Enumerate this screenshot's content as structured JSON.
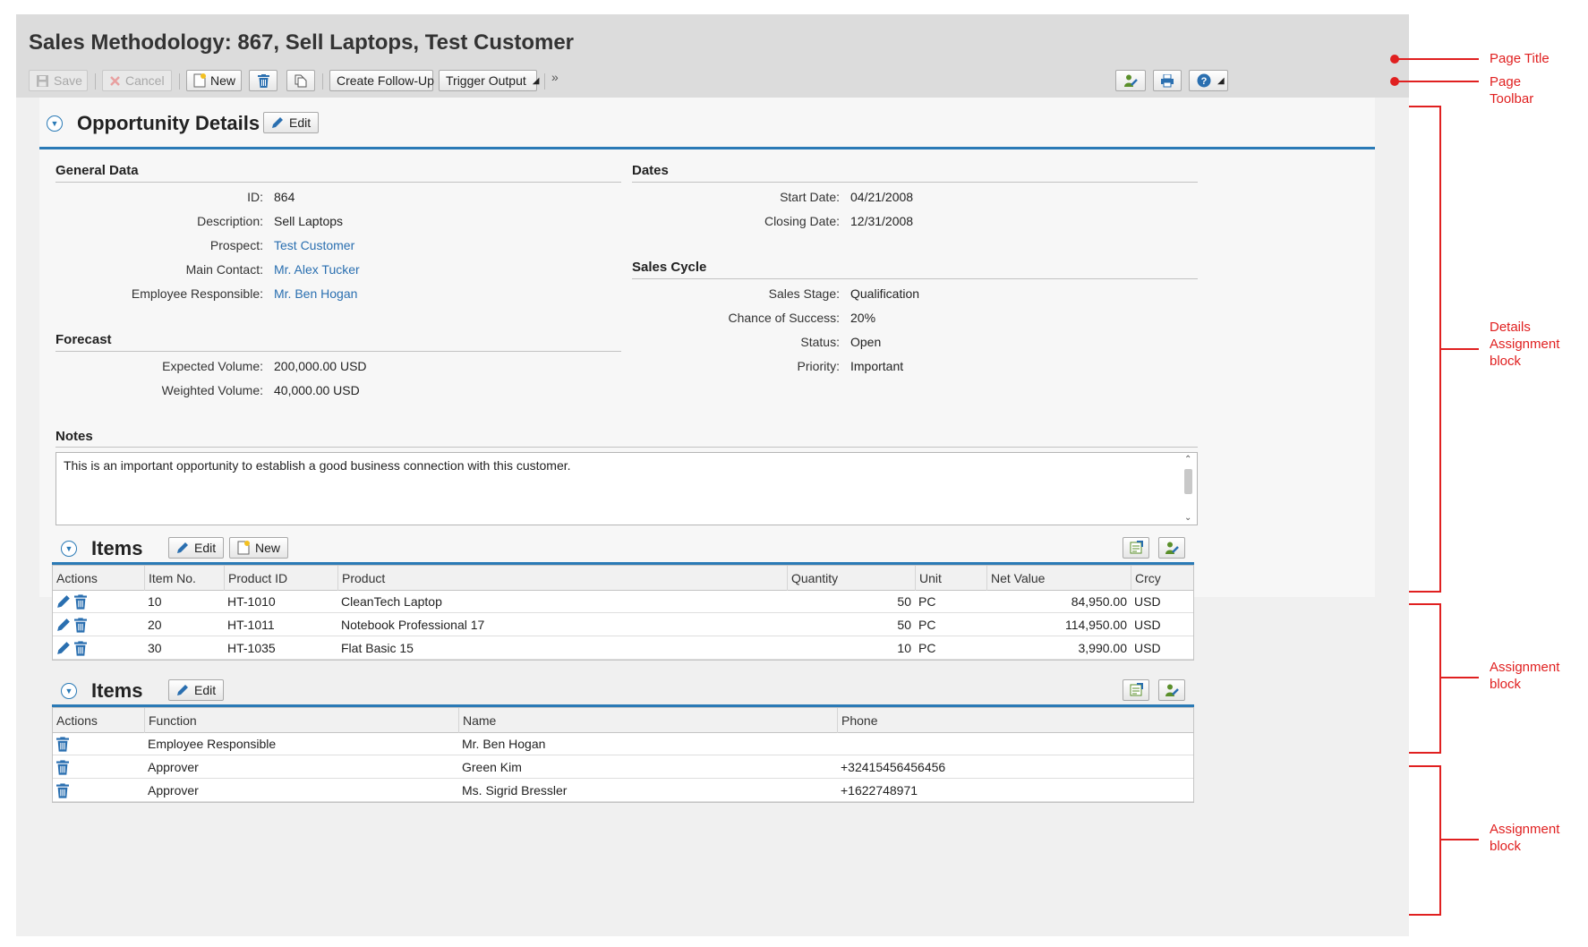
{
  "page": {
    "title": "Sales Methodology: 867, Sell Laptops, Test Customer"
  },
  "toolbar": {
    "save": "Save",
    "cancel": "Cancel",
    "new": "New",
    "create_follow_up": "Create Follow-Up",
    "trigger_output": "Trigger Output",
    "overflow": "»"
  },
  "details": {
    "title": "Opportunity Details",
    "edit": "Edit",
    "general_data": {
      "title": "General Data",
      "fields": [
        {
          "label": "ID:",
          "value": "864",
          "link": false
        },
        {
          "label": "Description:",
          "value": "Sell Laptops",
          "link": false
        },
        {
          "label": "Prospect:",
          "value": "Test Customer",
          "link": true
        },
        {
          "label": "Main Contact:",
          "value": "Mr. Alex Tucker",
          "link": true
        },
        {
          "label": "Employee Responsible:",
          "value": "Mr. Ben Hogan",
          "link": true
        }
      ]
    },
    "forecast": {
      "title": "Forecast",
      "fields": [
        {
          "label": "Expected Volume:",
          "value": "200,000.00 USD"
        },
        {
          "label": "Weighted Volume:",
          "value": "40,000.00 USD"
        }
      ]
    },
    "dates": {
      "title": "Dates",
      "fields": [
        {
          "label": "Start Date:",
          "value": "04/21/2008"
        },
        {
          "label": "Closing Date:",
          "value": "12/31/2008"
        }
      ]
    },
    "sales_cycle": {
      "title": "Sales Cycle",
      "fields": [
        {
          "label": "Sales Stage:",
          "value": "Qualification"
        },
        {
          "label": "Chance of Success:",
          "value": "20%"
        },
        {
          "label": "Status:",
          "value": "Open"
        },
        {
          "label": "Priority:",
          "value": "Important"
        }
      ]
    },
    "notes": {
      "title": "Notes",
      "text": "This is an important opportunity to establish a good business connection with this customer."
    }
  },
  "items_block": {
    "title": "Items",
    "edit": "Edit",
    "new": "New",
    "columns": [
      "Actions",
      "Item No.",
      "Product ID",
      "Product",
      "Quantity",
      "Unit",
      "Net Value",
      "Crcy"
    ],
    "rows": [
      {
        "item_no": "10",
        "product_id": "HT-1010",
        "product": "CleanTech Laptop",
        "quantity": "50",
        "unit": "PC",
        "net_value": "84,950.00",
        "crcy": "USD"
      },
      {
        "item_no": "20",
        "product_id": "HT-1011",
        "product": "Notebook Professional 17",
        "quantity": "50",
        "unit": "PC",
        "net_value": "114,950.00",
        "crcy": "USD"
      },
      {
        "item_no": "30",
        "product_id": "HT-1035",
        "product": "Flat Basic 15",
        "quantity": "10",
        "unit": "PC",
        "net_value": "3,990.00",
        "crcy": "USD"
      }
    ]
  },
  "parties_block": {
    "title": "Items",
    "edit": "Edit",
    "columns": [
      "Actions",
      "Function",
      "Name",
      "Phone"
    ],
    "rows": [
      {
        "function": "Employee Responsible",
        "name": "Mr. Ben Hogan",
        "phone": ""
      },
      {
        "function": "Approver",
        "name": "Green Kim",
        "phone": "+32415456456456"
      },
      {
        "function": "Approver",
        "name": "Ms. Sigrid Bressler",
        "phone": "+1622748971"
      }
    ]
  },
  "annotations": {
    "page_title": "Page Title",
    "page_toolbar": [
      "Page",
      "Toolbar"
    ],
    "details_block": [
      "Details",
      "Assignment",
      "block"
    ],
    "assignment_block_1": [
      "Assignment",
      "block"
    ],
    "assignment_block_2": [
      "Assignment",
      "block"
    ]
  },
  "colors": {
    "link": "#2a6fb0",
    "accent": "#2a7ab6",
    "annotation": "#e02020"
  },
  "icons": [
    "save-icon",
    "cancel-icon",
    "new-document-icon",
    "delete-icon",
    "copy-icon",
    "personalize-icon",
    "print-icon",
    "help-icon",
    "edit-pencil-icon",
    "collapse-icon",
    "export-icon"
  ]
}
